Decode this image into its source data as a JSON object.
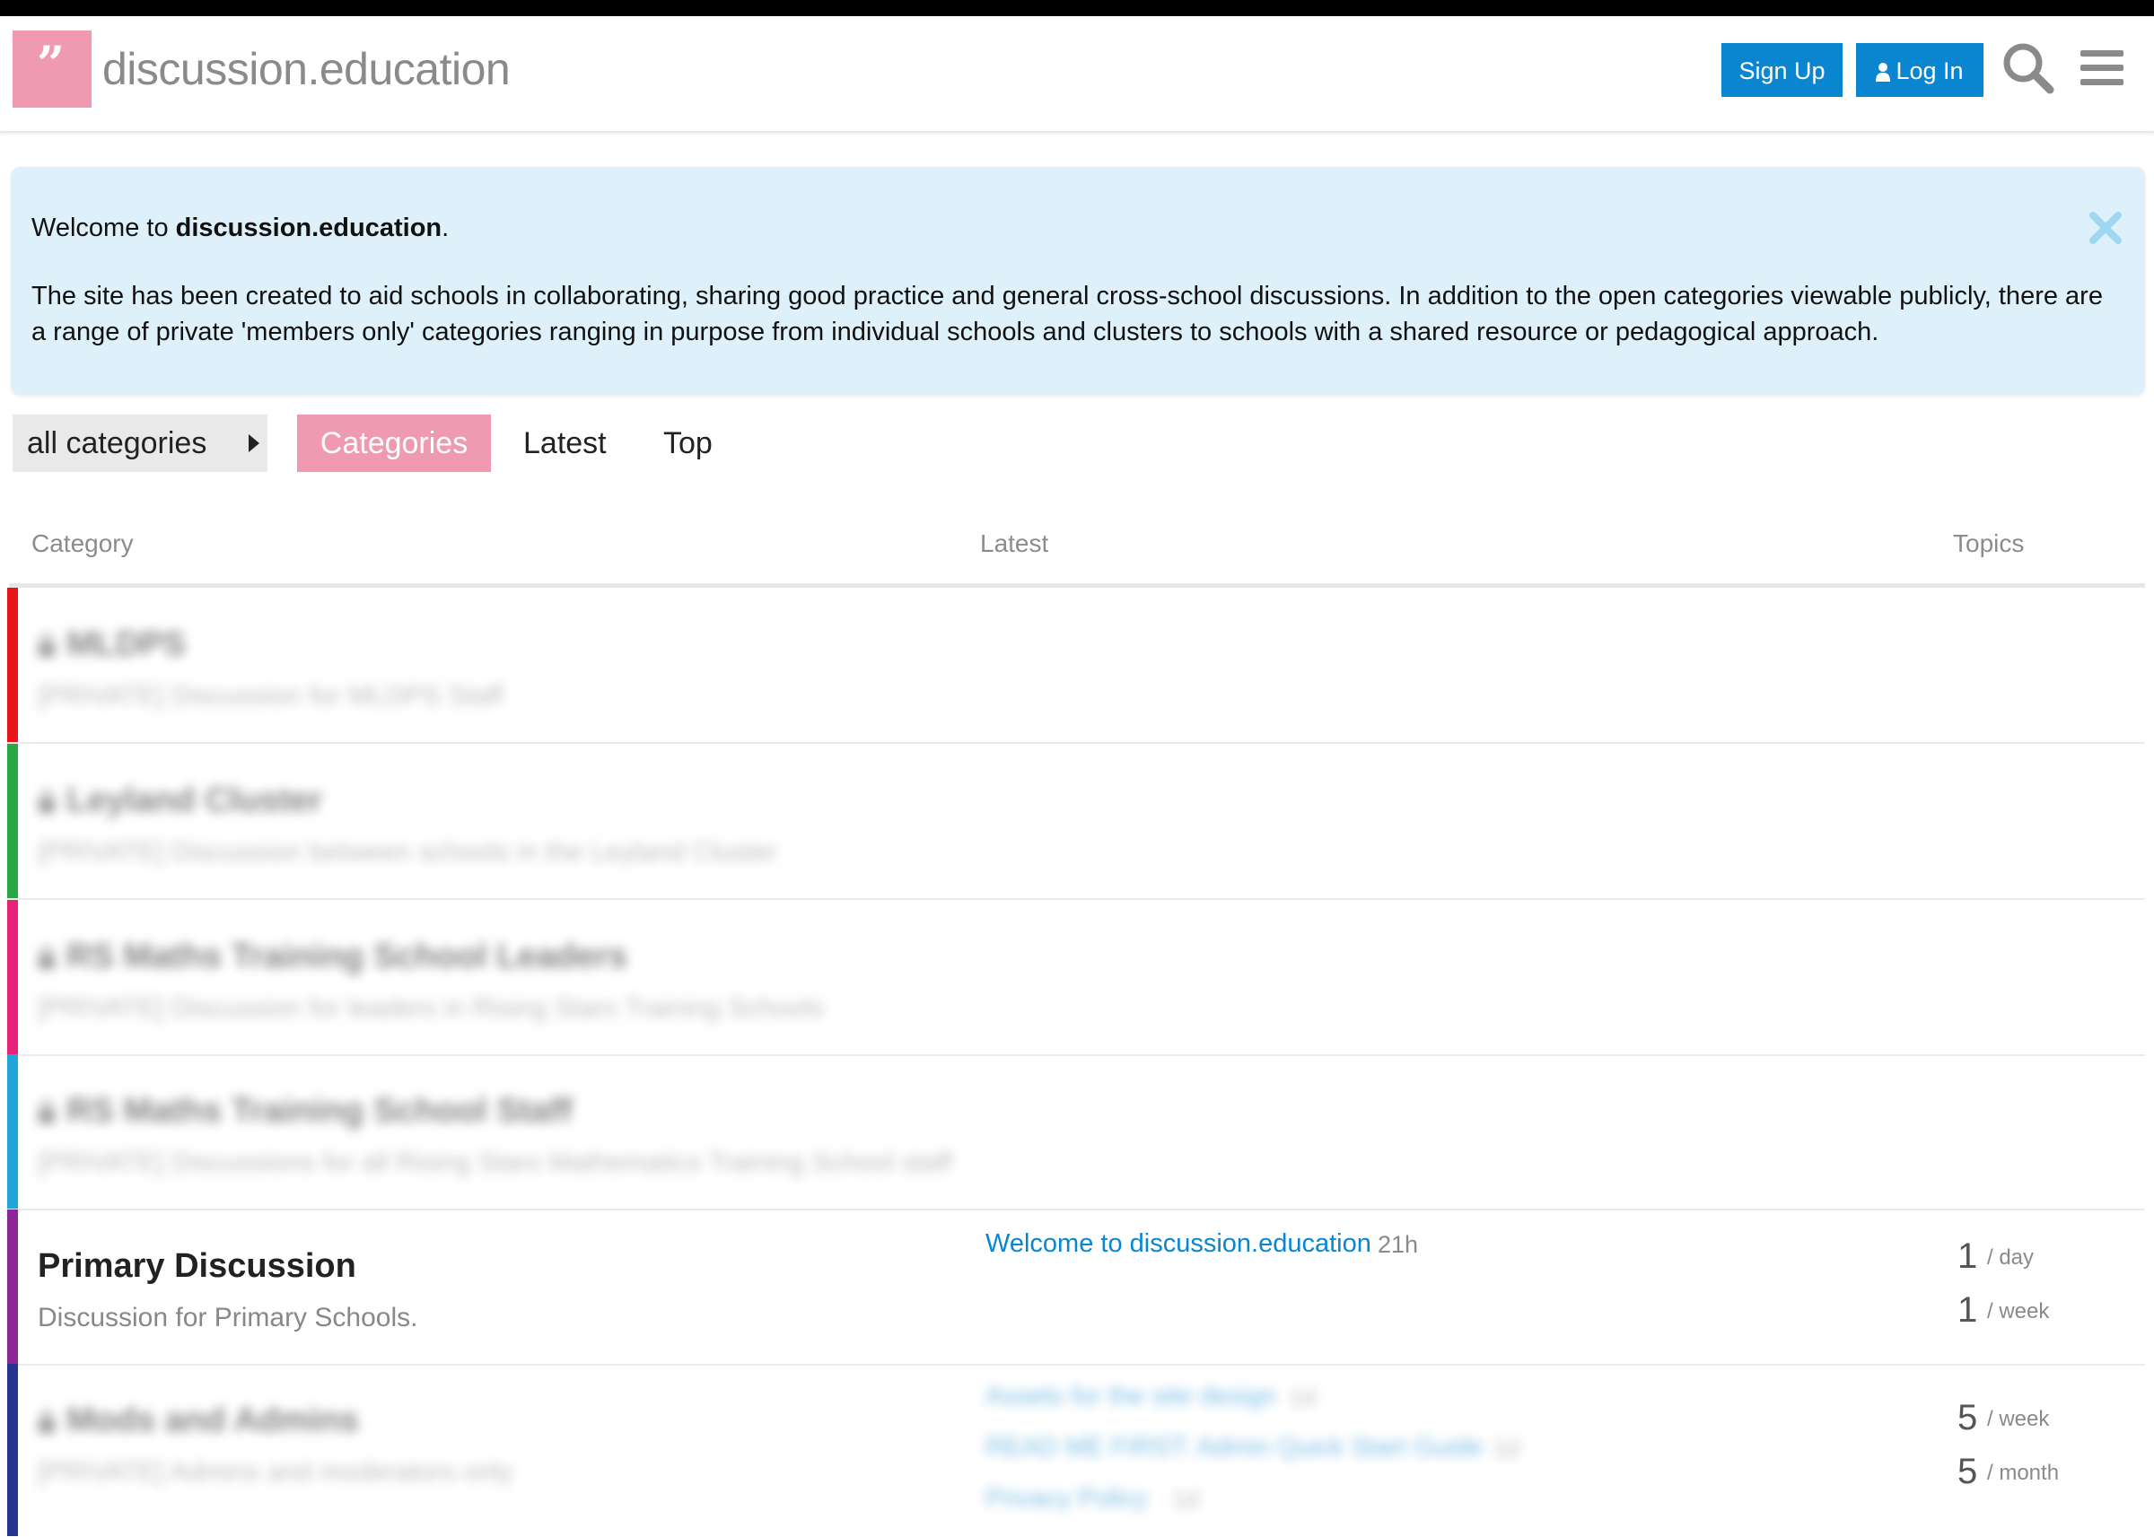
{
  "header": {
    "logo_glyph": "”",
    "site_title": "discussion.education",
    "signup_label": "Sign Up",
    "login_label": "Log In",
    "icons": [
      "search-icon",
      "hamburger-menu-icon",
      "user-icon"
    ],
    "accent_color": "#0a86d0",
    "brand_color": "#ef9ab0"
  },
  "banner": {
    "welcome_prefix": "Welcome to ",
    "welcome_site": "discussion.education",
    "welcome_suffix": ".",
    "body": "The site has been created to aid schools in collaborating, sharing good practice and general cross-school discussions. In addition to the open categories viewable publicly, there are a range of private 'members only' categories ranging in purpose from individual schools and clusters to schools with a shared resource or pedagogical approach.",
    "background_color": "#def1fb"
  },
  "nav": {
    "dropdown_label": "all categories",
    "tabs": [
      "Categories",
      "Latest",
      "Top"
    ],
    "active_tab": "Categories"
  },
  "table": {
    "columns": [
      "Category",
      "Latest",
      "Topics"
    ],
    "rows": [
      {
        "name": "MLDPS",
        "description": "[PRIVATE] Discussion for MLDPS Staff",
        "color": "#e8141a",
        "private": true,
        "blurred": true
      },
      {
        "name": "Leyland Cluster",
        "description": "[PRIVATE] Discussion between schools in the Leyland Cluster",
        "color": "#2aa843",
        "private": true,
        "blurred": true
      },
      {
        "name": "RS Maths Training School Leaders",
        "description": "[PRIVATE] Discussion for leaders in Rising Stars Training Schools",
        "color": "#e62378",
        "private": true,
        "blurred": true
      },
      {
        "name": "RS Maths Training School Staff",
        "description": "[PRIVATE] Discussions for all Rising Stars Mathematics Training School staff",
        "color": "#22a6d9",
        "private": true,
        "blurred": true
      },
      {
        "name": "Primary Discussion",
        "description": "Discussion for Primary Schools.",
        "color": "#8e2596",
        "private": false,
        "blurred": false,
        "latest": [
          {
            "title": "Welcome to discussion.education",
            "age": "21h"
          }
        ],
        "stats": [
          {
            "num": "1",
            "unit": "/ day"
          },
          {
            "num": "1",
            "unit": "/ week"
          }
        ]
      },
      {
        "name": "Mods and Admins",
        "description": "[PRIVATE] Admins and moderators only",
        "color": "#25358f",
        "private": true,
        "blurred": true,
        "latest": [
          {
            "title": "Assets for the site design",
            "age": "1d"
          },
          {
            "title": "READ ME FIRST: Admin Quick Start Guide",
            "age": "1d"
          },
          {
            "title": "Privacy Policy",
            "age": "1d"
          }
        ],
        "stats": [
          {
            "num": "5",
            "unit": "/ week"
          },
          {
            "num": "5",
            "unit": "/ month"
          }
        ]
      }
    ]
  }
}
